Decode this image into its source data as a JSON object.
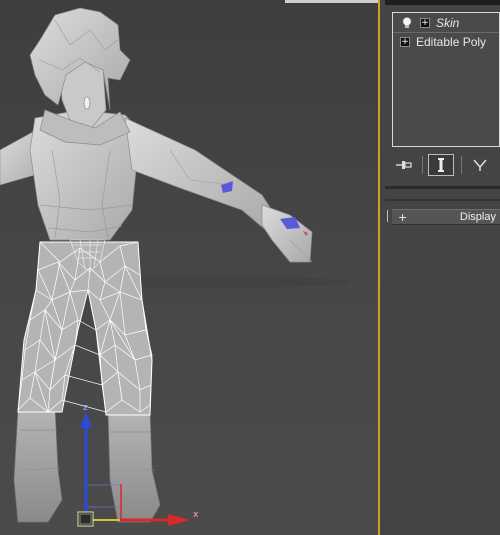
{
  "modifier_stack": {
    "items": [
      {
        "label": "Skin",
        "icon": "lightbulb-icon"
      },
      {
        "label": "Editable Poly",
        "icon": "plus-icon"
      }
    ]
  },
  "toolbar": {
    "pin_icon": "pin-stack-icon",
    "show_end_icon": "show-end-result-icon",
    "make_unique_icon": "make-unique-icon"
  },
  "rollout": {
    "expand_symbol": "+",
    "label": "Display"
  },
  "gizmo": {
    "z_label": "z",
    "x_label": "x"
  },
  "colors": {
    "viewport_border": "#c9a227",
    "panel_bg": "#444444",
    "selection_wire": "#ffffff",
    "skin_paint": "#5a5ad8",
    "axis_z": "#2a4cd8",
    "axis_x": "#d82a2a",
    "axis_y": "#c9c933"
  }
}
